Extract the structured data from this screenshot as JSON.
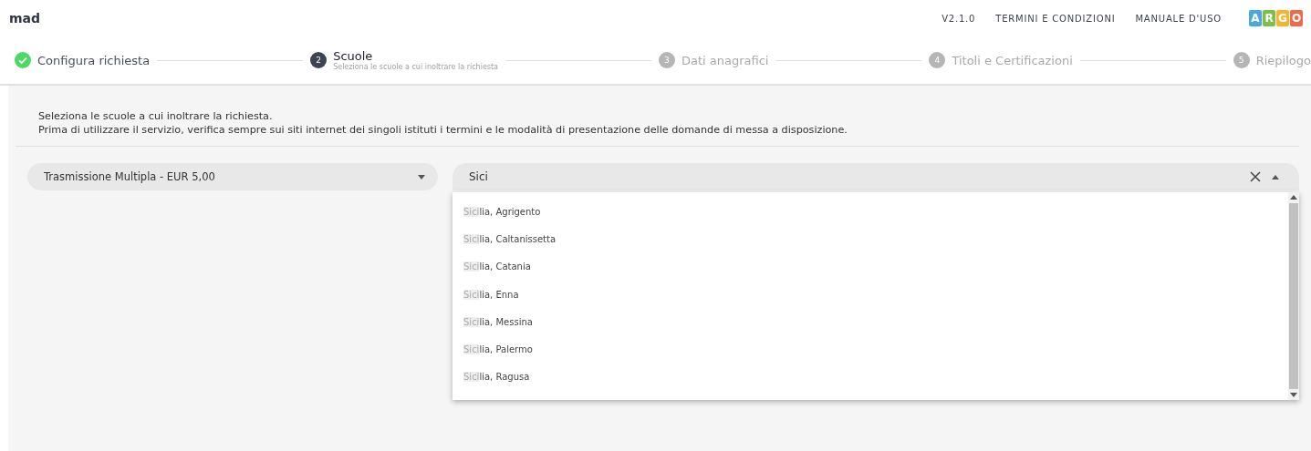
{
  "header": {
    "app_name": "mad",
    "links": [
      "V2.1.0",
      "TERMINI E CONDIZIONI",
      "MANUALE D'USO"
    ],
    "logo_letters": [
      {
        "letter": "A",
        "color": "#4aa8e0"
      },
      {
        "letter": "R",
        "color": "#7cc04b"
      },
      {
        "letter": "G",
        "color": "#f6b530"
      },
      {
        "letter": "O",
        "color": "#ef6a4a"
      }
    ]
  },
  "steps": [
    {
      "completed": true,
      "selected": false,
      "label": "Configura richiesta"
    },
    {
      "completed": false,
      "selected": true,
      "number": "2",
      "label": "Scuole",
      "sublabel": "Seleziona le scuole a cui inoltrare la richiesta"
    },
    {
      "completed": false,
      "selected": false,
      "number": "3",
      "label": "Dati anagrafici"
    },
    {
      "completed": false,
      "selected": false,
      "number": "4",
      "label": "Titoli e Certificazioni"
    },
    {
      "completed": false,
      "selected": false,
      "number": "5",
      "label": "Riepilogo"
    }
  ],
  "intro": [
    "Seleziona le scuole a cui inoltrare la richiesta.",
    "Prima di utilizzare il servizio, verifica sempre sui siti internet dei singoli istituti i termini e le modalità di presentazione delle domande di messa a disposizione."
  ],
  "transmission_select": {
    "value": "Trasmissione Multipla - EUR 5,00",
    "expanded": false
  },
  "school_search": {
    "value": "Sici",
    "expanded": true
  },
  "options": [
    {
      "match": "Sici",
      "rest": "lia, Agrigento"
    },
    {
      "match": "Sici",
      "rest": "lia, Caltanissetta"
    },
    {
      "match": "Sici",
      "rest": "lia, Catania"
    },
    {
      "match": "Sici",
      "rest": "lia, Enna"
    },
    {
      "match": "Sici",
      "rest": "lia, Messina"
    },
    {
      "match": "Sici",
      "rest": "lia, Palermo"
    },
    {
      "match": "Sici",
      "rest": "lia, Ragusa"
    }
  ]
}
